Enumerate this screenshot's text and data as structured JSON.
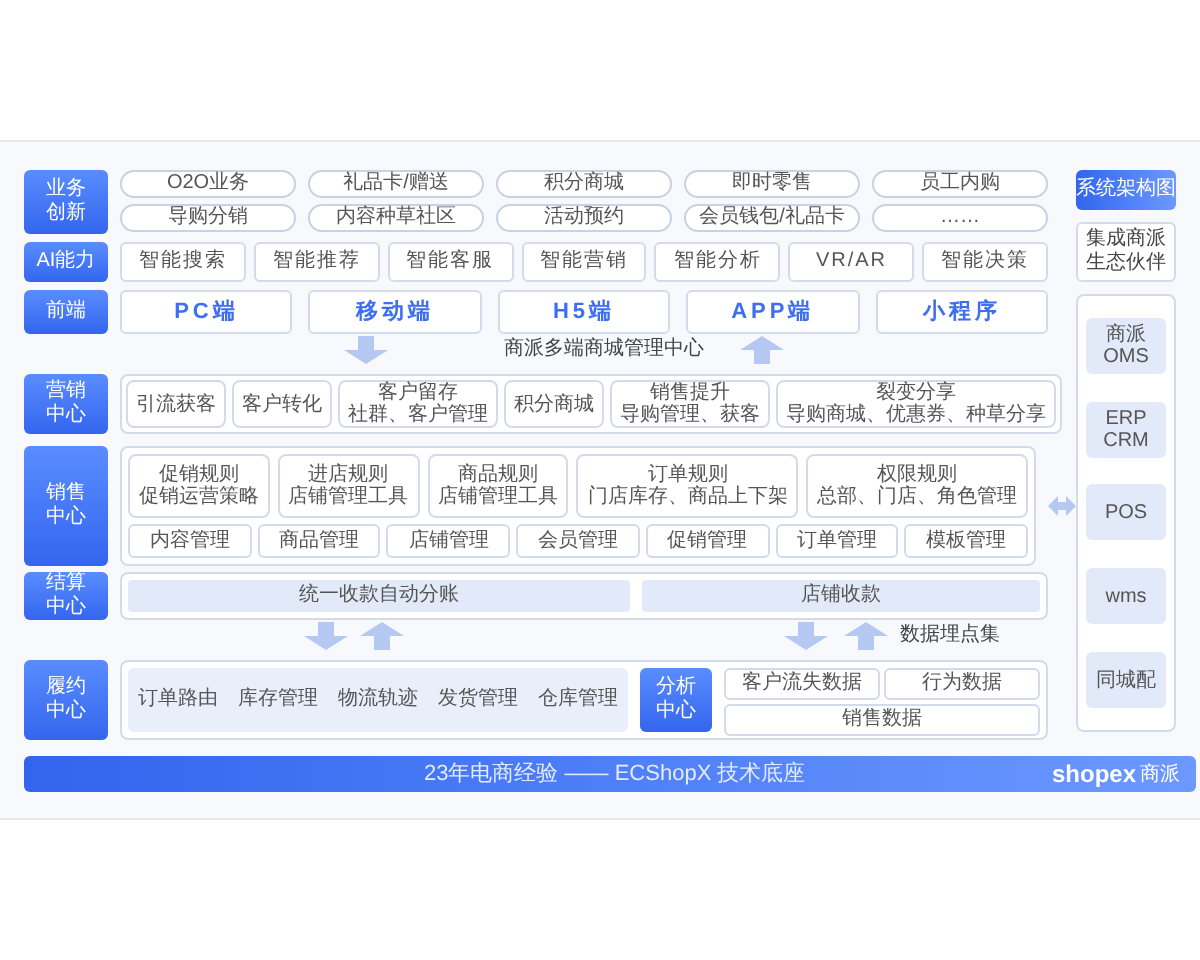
{
  "innovation": {
    "label": "业务创新",
    "rows": [
      [
        "O2O业务",
        "礼品卡/赠送",
        "积分商城",
        "即时零售",
        "员工内购"
      ],
      [
        "导购分销",
        "内容种草社区",
        "活动预约",
        "会员钱包/礼品卡",
        "……"
      ]
    ]
  },
  "ai": {
    "label": "AI能力",
    "items": [
      "智能搜索",
      "智能推荐",
      "智能客服",
      "智能营销",
      "智能分析",
      "VR/AR",
      "智能决策"
    ]
  },
  "frontend": {
    "label": "前端",
    "items": [
      "PC端",
      "移动端",
      "H5端",
      "APP端",
      "小程序"
    ]
  },
  "hub": {
    "caption": "商派多端商城管理中心"
  },
  "marketing": {
    "label": "营销中心",
    "items": [
      {
        "title": "引流获客"
      },
      {
        "title": "客户转化"
      },
      {
        "title": "客户留存",
        "detail": "社群、客户管理"
      },
      {
        "title": "积分商城"
      },
      {
        "title": "销售提升",
        "detail": "导购管理、获客"
      },
      {
        "title": "裂变分享",
        "detail": "导购商城、优惠券、种草分享"
      }
    ]
  },
  "sales": {
    "label": "销售中心",
    "rules": [
      {
        "title": "促销规则",
        "detail": "促销运营策略"
      },
      {
        "title": "进店规则",
        "detail": "店铺管理工具"
      },
      {
        "title": "商品规则",
        "detail": "店铺管理工具"
      },
      {
        "title": "订单规则",
        "detail": "门店库存、商品上下架"
      },
      {
        "title": "权限规则",
        "detail": "总部、门店、角色管理"
      }
    ],
    "modules": [
      "内容管理",
      "商品管理",
      "店铺管理",
      "会员管理",
      "促销管理",
      "订单管理",
      "模板管理"
    ]
  },
  "settlement": {
    "label": "结算中心",
    "items": [
      "统一收款自动分账",
      "店铺收款"
    ]
  },
  "data_collection": {
    "caption": "数据埋点集"
  },
  "fulfillment": {
    "label": "履约中心",
    "items": [
      "订单路由",
      "库存管理",
      "物流轨迹",
      "发货管理",
      "仓库管理"
    ],
    "analysis": {
      "label": "分析中心",
      "items": [
        "客户流失数据",
        "行为数据",
        "销售数据"
      ]
    }
  },
  "footer": {
    "slogan": "23年电商经验 —— ECShopX 技术底座",
    "brand": "shopex",
    "brand_sub": "商派"
  },
  "sidebar": {
    "button": "系统架构图",
    "partner": "集成商派生态伙伴",
    "systems": [
      "商派OMS",
      "ERP\nCRM",
      "POS",
      "wms",
      "同城配"
    ]
  }
}
